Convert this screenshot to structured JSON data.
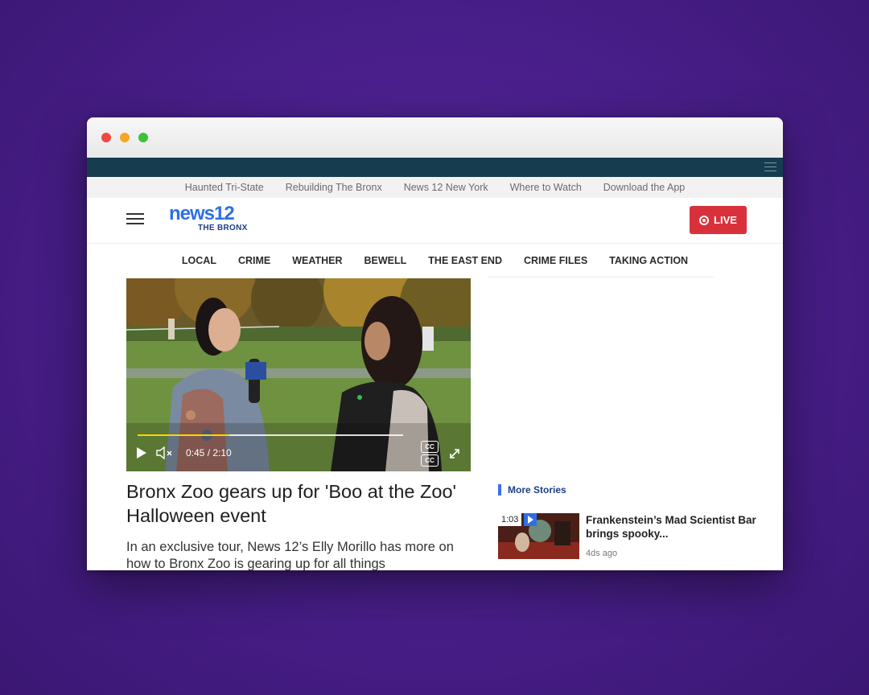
{
  "browser": {
    "controls": [
      "close",
      "minimize",
      "maximize"
    ]
  },
  "secondary_nav": {
    "items": [
      "Haunted Tri-State",
      "Rebuilding The Bronx",
      "News 12 New York",
      "Where to Watch",
      "Download the App"
    ]
  },
  "header": {
    "logo_word": "news12",
    "logo_sub": "THE BRONX",
    "live_label": "LIVE",
    "brand_color": "#2f6fe4",
    "live_color": "#d8313b"
  },
  "main_nav": {
    "items": [
      "LOCAL",
      "CRIME",
      "WEATHER",
      "BEWELL",
      "THE EAST END",
      "CRIME FILES",
      "TAKING ACTION"
    ]
  },
  "video": {
    "timecode": "0:45 / 2:10",
    "progress_fraction": 0.346,
    "cc_labels": [
      "CC",
      "CC"
    ],
    "mic_flag": "12"
  },
  "article": {
    "headline": "Bronx Zoo gears up for 'Boo at the Zoo' Halloween event",
    "summary": "In an exclusive tour, News 12’s Elly Morillo has more on how to Bronx Zoo is gearing up for all things"
  },
  "sidebar": {
    "more_stories_label": "More Stories",
    "stories": [
      {
        "duration": "1:03",
        "title": "Frankenstein’s Mad Scientist Bar brings spooky...",
        "time": "4ds ago"
      }
    ]
  }
}
